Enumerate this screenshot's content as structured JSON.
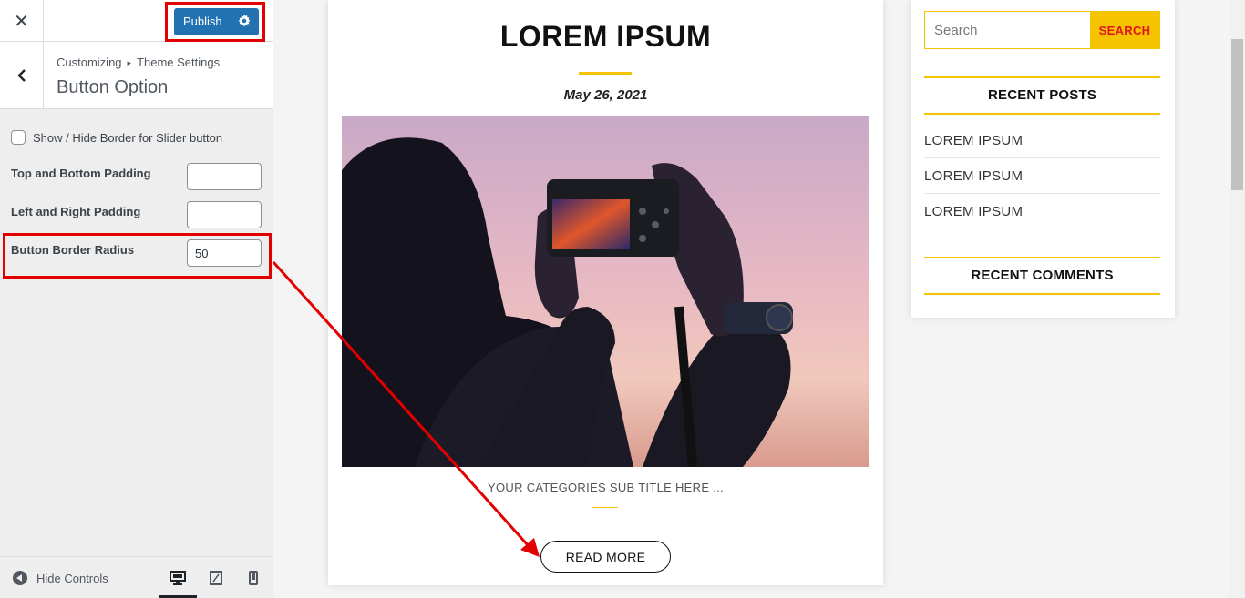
{
  "customizer": {
    "publish_label": "Publish",
    "breadcrumb": {
      "root": "Customizing",
      "sep": "▸",
      "parent": "Theme Settings"
    },
    "section_title": "Button Option",
    "controls": {
      "border_toggle_label": "Show / Hide Border for Slider button",
      "border_toggle_checked": false,
      "top_bottom_label": "Top and Bottom Padding",
      "top_bottom_value": "",
      "left_right_label": "Left and Right Padding",
      "left_right_value": "",
      "border_radius_label": "Button Border Radius",
      "border_radius_value": "50"
    },
    "footer": {
      "hide_controls_label": "Hide Controls",
      "active_device": "desktop"
    }
  },
  "preview": {
    "post": {
      "title": "LOREM IPSUM",
      "date": "May 26, 2021",
      "subtitle": "YOUR CATEGORIES SUB TITLE HERE ...",
      "read_more_label": "READ MORE"
    },
    "sidebar": {
      "search_placeholder": "Search",
      "search_button": "SEARCH",
      "recent_posts_title": "RECENT POSTS",
      "recent_posts": [
        "LOREM IPSUM",
        "LOREM IPSUM",
        "LOREM IPSUM"
      ],
      "recent_comments_title": "RECENT COMMENTS"
    }
  },
  "colors": {
    "accent": "#f5c300",
    "publish": "#2271b1",
    "annotation": "#e30000",
    "search_text": "#e0161b"
  },
  "icons": [
    "close-icon",
    "gear-icon",
    "chevron-left-icon",
    "hide-controls-icon",
    "desktop-icon",
    "tablet-icon",
    "mobile-icon"
  ]
}
